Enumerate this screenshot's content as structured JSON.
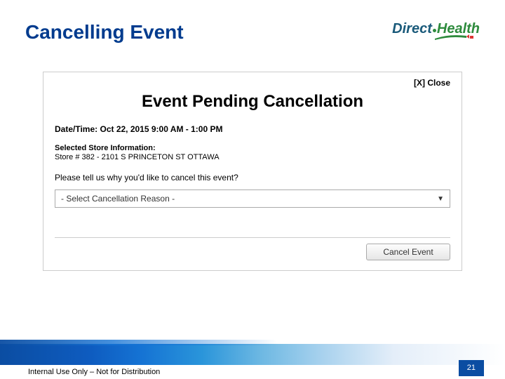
{
  "header": {
    "title": "Cancelling Event",
    "logo": {
      "part1": "Direct",
      "part2": "Health"
    }
  },
  "dialog": {
    "close_label": "[X] Close",
    "title": "Event Pending Cancellation",
    "datetime_label": "Date/Time:",
    "datetime_value": "Oct 22, 2015 9:00 AM - 1:00 PM",
    "store_header": "Selected Store Information:",
    "store_line": "Store # 382 - 2101 S PRINCETON ST OTTAWA",
    "question": "Please tell us why you'd like to cancel this event?",
    "select_placeholder": "- Select Cancellation Reason -",
    "cancel_button": "Cancel Event"
  },
  "footer": {
    "notice": "Internal Use Only – Not for Distribution",
    "page_number": "21"
  }
}
